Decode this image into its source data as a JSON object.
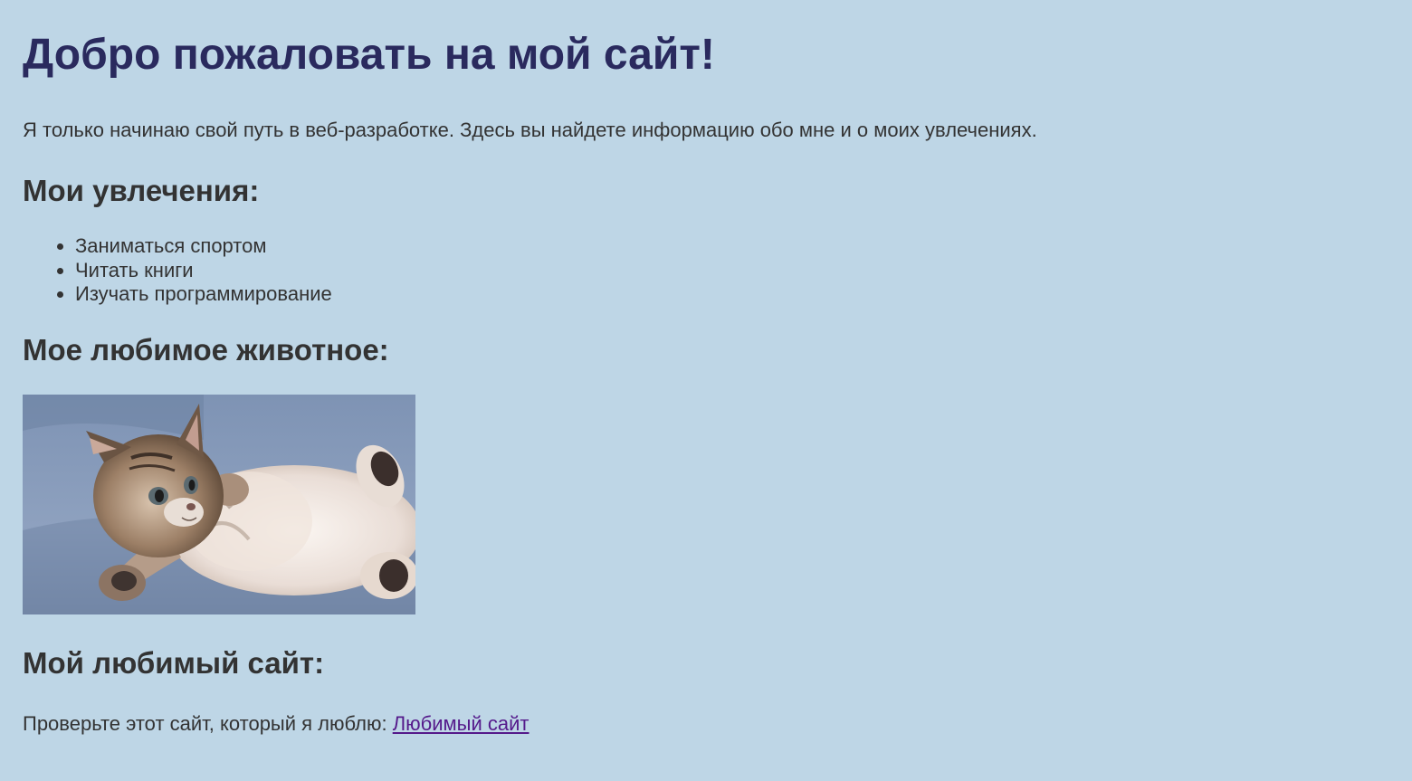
{
  "header": {
    "title": "Добро пожаловать на мой сайт!"
  },
  "intro": {
    "text": "Я только начинаю свой путь в веб-разработке. Здесь вы найдете информацию обо мне и о моих увлечениях."
  },
  "hobbies": {
    "heading": "Мои увлечения:",
    "items": [
      {
        "label": "Заниматься спортом"
      },
      {
        "label": "Читать книги"
      },
      {
        "label": "Изучать программирование"
      }
    ]
  },
  "animal": {
    "heading": "Мое любимое животное:",
    "image": "kitten-photo"
  },
  "favorite_site": {
    "heading": "Мой любимый сайт:",
    "text": "Проверьте этот сайт, который я люблю:",
    "link_label": "Любимый сайт"
  },
  "colors": {
    "background": "#bed6e6",
    "title": "#2a2a5e",
    "text": "#333333",
    "link_visited": "#551a8b"
  }
}
